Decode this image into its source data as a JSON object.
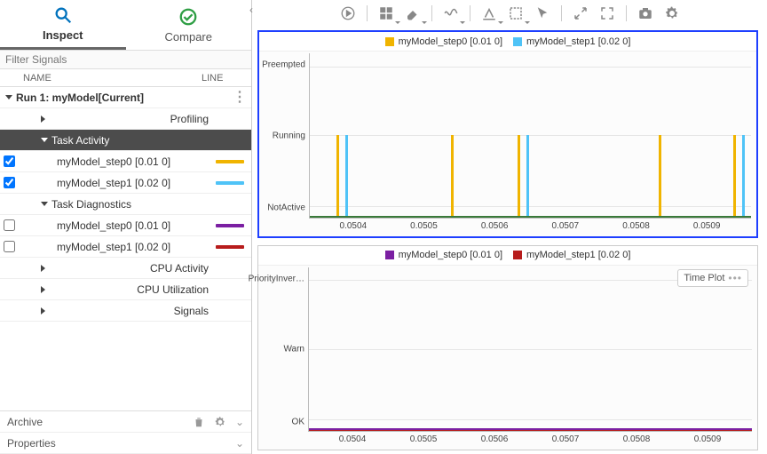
{
  "tabs": {
    "inspect": "Inspect",
    "compare": "Compare"
  },
  "filter_placeholder": "Filter Signals",
  "columns": {
    "name": "NAME",
    "line": "LINE"
  },
  "run": {
    "label": "Run 1: myModel[Current]"
  },
  "tree": {
    "profiling": "Profiling",
    "task_activity": "Task Activity",
    "ta_s0": "myModel_step0 [0.01 0]",
    "ta_s1": "myModel_step1 [0.02 0]",
    "task_diag": "Task Diagnostics",
    "td_s0": "myModel_step0 [0.01 0]",
    "td_s1": "myModel_step1 [0.02 0]",
    "cpu_act": "CPU Activity",
    "cpu_util": "CPU Utilization",
    "signals": "Signals"
  },
  "colors": {
    "ta_s0": "#f0b400",
    "ta_s1": "#4fc3f7",
    "td_s0": "#7b1fa2",
    "td_s1": "#b71c1c"
  },
  "footer": {
    "archive": "Archive",
    "properties": "Properties"
  },
  "plot1": {
    "legend": {
      "s0": "myModel_step0 [0.01 0]",
      "s1": "myModel_step1 [0.02 0]"
    },
    "ylabels": {
      "y0": "Preempted",
      "y1": "Running",
      "y2": "NotActive"
    }
  },
  "plot2": {
    "legend": {
      "s0": "myModel_step0 [0.01 0]",
      "s1": "myModel_step1 [0.02 0]"
    },
    "ylabels": {
      "y0": "PriorityInver…",
      "y1": "Warn",
      "y2": "OK"
    },
    "badge": "Time Plot"
  },
  "ticks": {
    "t0": "0.0504",
    "t1": "0.0505",
    "t2": "0.0506",
    "t3": "0.0507",
    "t4": "0.0508",
    "t5": "0.0509"
  },
  "chart_data": [
    {
      "type": "line",
      "title": "Task Activity",
      "xlabel": "",
      "ylabel": "",
      "xlim": [
        0.05034,
        0.05096
      ],
      "y_categories": [
        "NotActive",
        "Running",
        "Preempted"
      ],
      "series": [
        {
          "name": "myModel_step0 [0.01 0]",
          "color": "#f0b400",
          "events": [
            {
              "x": 0.05038,
              "from": "NotActive",
              "to": "Running",
              "to_back": "NotActive"
            },
            {
              "x": 0.05054,
              "from": "NotActive",
              "to": "Running",
              "to_back": "NotActive"
            },
            {
              "x": 0.05063,
              "from": "NotActive",
              "to": "Running",
              "to_back": "NotActive"
            },
            {
              "x": 0.05083,
              "from": "NotActive",
              "to": "Running",
              "to_back": "NotActive"
            },
            {
              "x": 0.05094,
              "from": "NotActive",
              "to": "Running",
              "to_back": "NotActive"
            }
          ]
        },
        {
          "name": "myModel_step1 [0.02 0]",
          "color": "#4fc3f7",
          "events": [
            {
              "x": 0.05039,
              "from": "NotActive",
              "to": "Running",
              "to_back": "NotActive"
            },
            {
              "x": 0.05064,
              "from": "NotActive",
              "to": "Running",
              "to_back": "NotActive"
            },
            {
              "x": 0.05095,
              "from": "NotActive",
              "to": "Running",
              "to_back": "NotActive"
            }
          ]
        }
      ]
    },
    {
      "type": "line",
      "title": "Task Diagnostics",
      "xlabel": "",
      "ylabel": "",
      "xlim": [
        0.05034,
        0.05096
      ],
      "y_categories": [
        "OK",
        "Warn",
        "PriorityInversion"
      ],
      "series": [
        {
          "name": "myModel_step0 [0.01 0]",
          "color": "#7b1fa2",
          "baseline": "OK",
          "events": []
        },
        {
          "name": "myModel_step1 [0.02 0]",
          "color": "#b71c1c",
          "baseline": "OK",
          "events": []
        }
      ]
    }
  ]
}
